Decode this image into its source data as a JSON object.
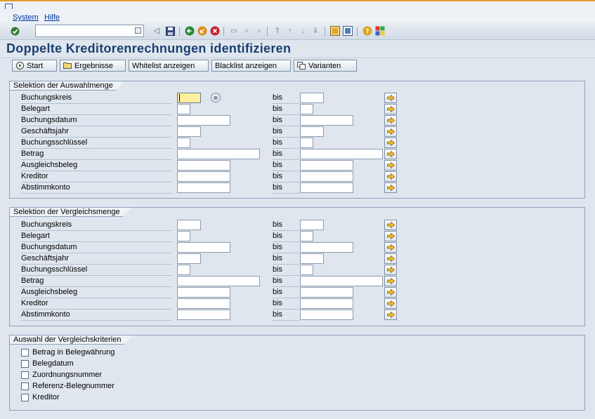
{
  "menu": {
    "items": [
      "System",
      "Hilfe"
    ]
  },
  "toolbar": {
    "command_value": ""
  },
  "page": {
    "title": "Doppelte Kreditorenrechnungen identifizieren"
  },
  "app_toolbar": {
    "start": "Start",
    "ergebnisse": "Ergebnisse",
    "whitelist": "Whitelist anzeigen",
    "blacklist": "Blacklist anzeigen",
    "varianten": "Varianten"
  },
  "selection_auswahl": {
    "title": "Selektion der Auswahlmenge",
    "bis": "bis",
    "fields": [
      "Buchungskreis",
      "Belegart",
      "Buchungsdatum",
      "Geschäftsjahr",
      "Buchungsschlüssel",
      "Betrag",
      "Ausgleichsbeleg",
      "Kreditor",
      "Abstimmkonto"
    ]
  },
  "selection_vergleich": {
    "title": "Selektion der Vergleichsmenge",
    "bis": "bis",
    "fields": [
      "Buchungskreis",
      "Belegart",
      "Buchungsdatum",
      "Geschäftsjahr",
      "Buchungsschlüssel",
      "Betrag",
      "Ausgleichsbeleg",
      "Kreditor",
      "Abstimmkonto"
    ]
  },
  "criteria": {
    "title": "Auswahl der Vergleichskriterien",
    "items": [
      "Betrag in Belegwährung",
      "Belegdatum",
      "Zuordnungsnummer",
      "Referenz-Belegnummer",
      "Kreditor"
    ]
  }
}
